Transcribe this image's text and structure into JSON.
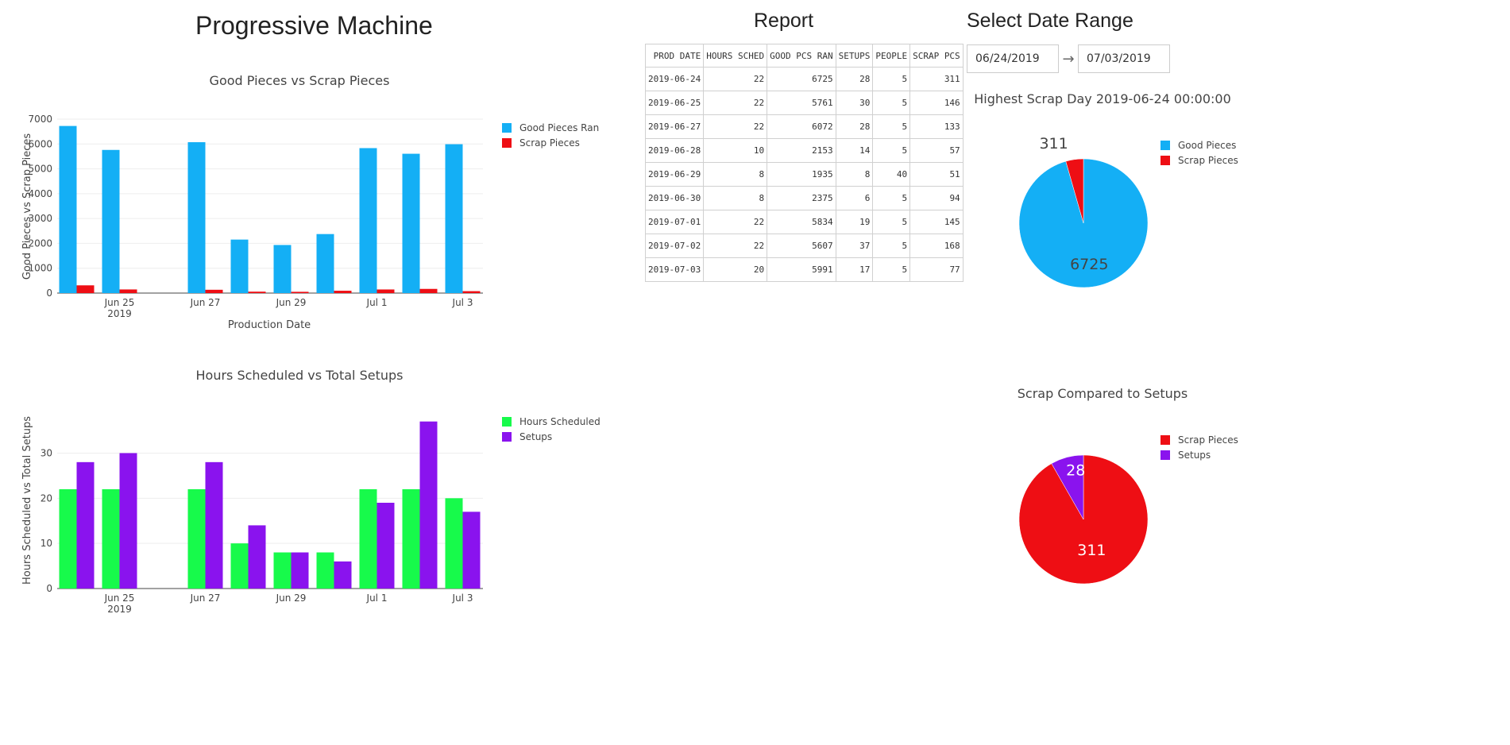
{
  "page": {
    "title": "Progressive Machine"
  },
  "colors": {
    "good": "#14aff5",
    "scrap": "#ee0e14",
    "hours": "#17fa4b",
    "setups": "#8a13ee"
  },
  "report": {
    "title": "Report",
    "columns": [
      "PROD DATE",
      "HOURS SCHED",
      "GOOD PCS RAN",
      "SETUPS",
      "PEOPLE",
      "SCRAP PCS"
    ],
    "rows": [
      [
        "2019-06-24",
        "22",
        "6725",
        "28",
        "5",
        "311"
      ],
      [
        "2019-06-25",
        "22",
        "5761",
        "30",
        "5",
        "146"
      ],
      [
        "2019-06-27",
        "22",
        "6072",
        "28",
        "5",
        "133"
      ],
      [
        "2019-06-28",
        "10",
        "2153",
        "14",
        "5",
        "57"
      ],
      [
        "2019-06-29",
        "8",
        "1935",
        "8",
        "40",
        "51"
      ],
      [
        "2019-06-30",
        "8",
        "2375",
        "6",
        "5",
        "94"
      ],
      [
        "2019-07-01",
        "22",
        "5834",
        "19",
        "5",
        "145"
      ],
      [
        "2019-07-02",
        "22",
        "5607",
        "37",
        "5",
        "168"
      ],
      [
        "2019-07-03",
        "20",
        "5991",
        "17",
        "5",
        "77"
      ]
    ]
  },
  "date_range": {
    "title": "Select Date Range",
    "start": "06/24/2019",
    "end": "07/03/2019",
    "separator": "→"
  },
  "chart_data": [
    {
      "type": "bar",
      "title": "Good Pieces vs Scrap Pieces",
      "xlabel": "Production Date",
      "ylabel": "Good Pieces vs Scrap Pieces",
      "x": [
        "2019-06-24",
        "2019-06-25",
        "2019-06-27",
        "2019-06-28",
        "2019-06-29",
        "2019-06-30",
        "2019-07-01",
        "2019-07-02",
        "2019-07-03"
      ],
      "series": [
        {
          "name": "Good Pieces Ran",
          "values": [
            6725,
            5761,
            6072,
            2153,
            1935,
            2375,
            5834,
            5607,
            5991
          ]
        },
        {
          "name": "Scrap Pieces",
          "values": [
            311,
            146,
            133,
            57,
            51,
            94,
            145,
            168,
            77
          ]
        }
      ],
      "ylim": [
        0,
        7000
      ],
      "yticks": [
        "0",
        "1000",
        "2000",
        "3000",
        "4000",
        "5000",
        "6000",
        "7000"
      ],
      "xticks": [
        "Jun 25",
        "Jun 27",
        "Jun 29",
        "Jul 1",
        "Jul 3"
      ],
      "xticks_sub": "2019",
      "grid": true,
      "legend": "top-right"
    },
    {
      "type": "bar",
      "title": "Hours Scheduled vs Total Setups",
      "xlabel": "",
      "ylabel": "Hours Scheduled vs Total Setups",
      "x": [
        "2019-06-24",
        "2019-06-25",
        "2019-06-27",
        "2019-06-28",
        "2019-06-29",
        "2019-06-30",
        "2019-07-01",
        "2019-07-02",
        "2019-07-03"
      ],
      "series": [
        {
          "name": "Hours Scheduled",
          "values": [
            22,
            22,
            22,
            10,
            8,
            8,
            22,
            22,
            20
          ]
        },
        {
          "name": "Setups",
          "values": [
            28,
            30,
            28,
            14,
            8,
            6,
            19,
            37,
            17
          ]
        }
      ],
      "ylim": [
        0,
        38
      ],
      "yticks": [
        "0",
        "10",
        "20",
        "30"
      ],
      "xticks": [
        "Jun 25",
        "Jun 27",
        "Jun 29",
        "Jul 1",
        "Jul 3"
      ],
      "xticks_sub": "2019",
      "grid": true,
      "legend": "top-right"
    },
    {
      "type": "pie",
      "title": "Highest Scrap Day 2019-06-24 00:00:00",
      "labels": [
        "Good Pieces",
        "Scrap Pieces"
      ],
      "values": [
        6725,
        311
      ],
      "legend": "top-right"
    },
    {
      "type": "pie",
      "title": "Scrap Compared to Setups",
      "labels": [
        "Scrap Pieces",
        "Setups"
      ],
      "values": [
        311,
        28
      ],
      "legend": "top-right"
    }
  ]
}
